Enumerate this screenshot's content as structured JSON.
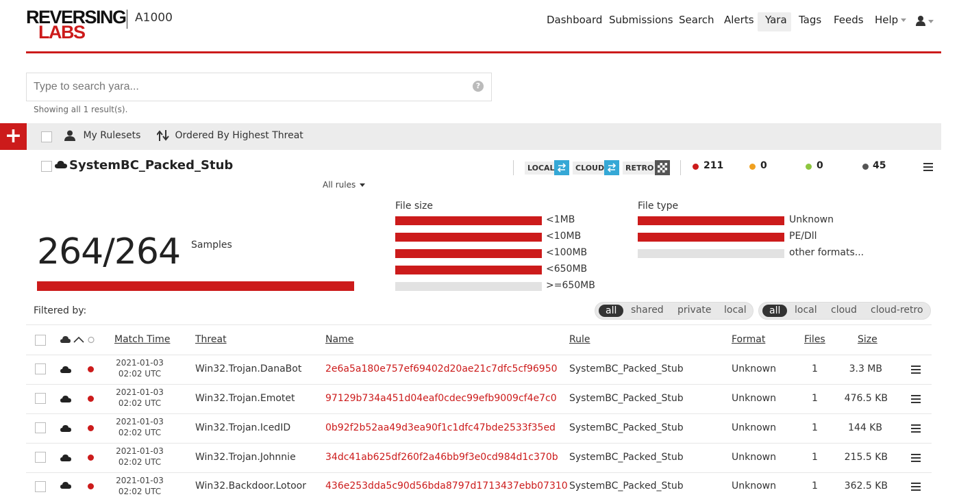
{
  "header": {
    "logo_line1": "REVERSING",
    "logo_line2": "LABS",
    "product": "A1000",
    "nav": [
      "Dashboard",
      "Submissions",
      "Search",
      "Alerts",
      "Yara",
      "Tags",
      "Feeds",
      "Help"
    ],
    "active_nav": "Yara"
  },
  "search": {
    "placeholder": "Type to search yara...",
    "showing": "Showing all 1 result(s)."
  },
  "toolbar": {
    "add_label": "+",
    "my_rulesets": "My Rulesets",
    "order": "Ordered By Highest Threat"
  },
  "ruleset": {
    "name": "SystemBC_Packed_Stub",
    "badges": [
      "LOCAL",
      "CLOUD",
      "RETRO"
    ],
    "counts": [
      {
        "value": "211",
        "color": "#cc1b1b"
      },
      {
        "value": "0",
        "color": "#f0a020"
      },
      {
        "value": "0",
        "color": "#8dc63f"
      },
      {
        "value": "45",
        "color": "#555555"
      }
    ],
    "all_rules": "All rules"
  },
  "stats": {
    "matched": "264/264",
    "samples_label": "Samples",
    "samples_fraction": 1.0,
    "file_size_title": "File size",
    "file_size": [
      {
        "label": "<1MB",
        "filled": true
      },
      {
        "label": "<10MB",
        "filled": true
      },
      {
        "label": "<100MB",
        "filled": true
      },
      {
        "label": "<650MB",
        "filled": true
      },
      {
        "label": ">=650MB",
        "filled": false
      }
    ],
    "file_type_title": "File type",
    "file_type": [
      {
        "label": "Unknown",
        "filled": true
      },
      {
        "label": "PE/Dll",
        "filled": true
      },
      {
        "label": "other formats...",
        "filled": false
      }
    ]
  },
  "filters": {
    "label": "Filtered by:",
    "group1": [
      "all",
      "shared",
      "private",
      "local"
    ],
    "group2": [
      "all",
      "local",
      "cloud",
      "cloud-retro"
    ]
  },
  "table": {
    "headers": {
      "match_time": "Match Time",
      "threat": "Threat",
      "name": "Name",
      "rule": "Rule",
      "format": "Format",
      "files": "Files",
      "size": "Size"
    },
    "rows": [
      {
        "date": "2021-01-03",
        "time": "02:02 UTC",
        "threat": "Win32.Trojan.DanaBot",
        "name": "2e6a5a180e757ef69402d20ae21c7dfc5cf96950",
        "rule": "SystemBC_Packed_Stub",
        "format": "Unknown",
        "files": "1",
        "size": "3.3 MB"
      },
      {
        "date": "2021-01-03",
        "time": "02:02 UTC",
        "threat": "Win32.Trojan.Emotet",
        "name": "97129b734a451d04eaf0cdec99efb9009cf4e7c0",
        "rule": "SystemBC_Packed_Stub",
        "format": "Unknown",
        "files": "1",
        "size": "476.5 KB"
      },
      {
        "date": "2021-01-03",
        "time": "02:02 UTC",
        "threat": "Win32.Trojan.IcedID",
        "name": "0b92f2b52aa49d3ea90f1c1dfc47bde2533f35ed",
        "rule": "SystemBC_Packed_Stub",
        "format": "Unknown",
        "files": "1",
        "size": "144 KB"
      },
      {
        "date": "2021-01-03",
        "time": "02:02 UTC",
        "threat": "Win32.Trojan.Johnnie",
        "name": "34dc41ab625df260f2a46bb9f3e0cd984d1c370b",
        "rule": "SystemBC_Packed_Stub",
        "format": "Unknown",
        "files": "1",
        "size": "215.5 KB"
      },
      {
        "date": "2021-01-03",
        "time": "02:02 UTC",
        "threat": "Win32.Backdoor.Lotoor",
        "name": "436e253dda5c90d56bda8797d1713437ebb07310",
        "rule": "SystemBC_Packed_Stub",
        "format": "Unknown",
        "files": "1",
        "size": "362.5 KB"
      }
    ]
  },
  "icons": {
    "user": "user-icon",
    "sort": "sort-icon",
    "cloud": "cloud-icon",
    "menu": "hamburger-menu-icon",
    "help": "help-icon",
    "sync": "sync-icon",
    "retro": "checkered-icon"
  }
}
